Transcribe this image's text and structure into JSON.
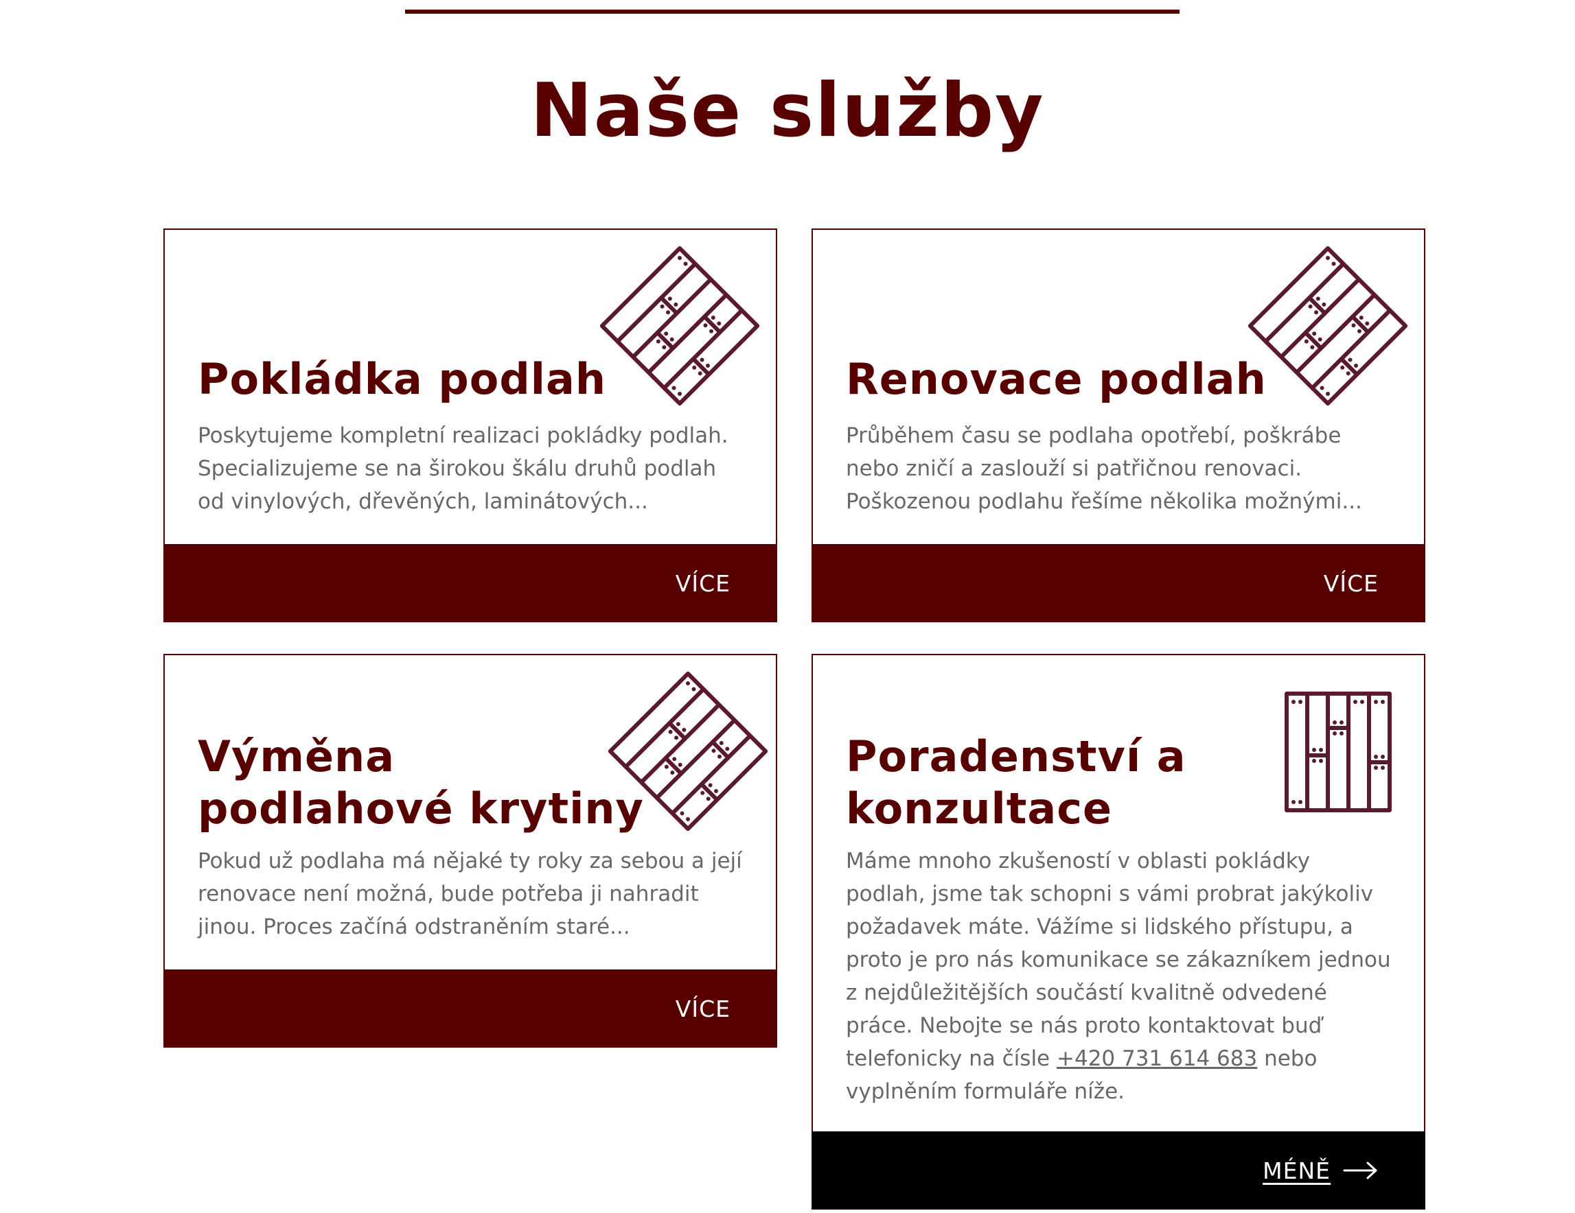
{
  "heading": "Naše služby",
  "colors": {
    "accent": "#580000",
    "text_muted": "#676767",
    "footer_active": "#000000"
  },
  "cards": [
    {
      "title": "Pokládka podlah",
      "text": "Poskytujeme kompletní realizaci pokládky podlah. Specializujeme se na širokou škálu druhů podlah od vinylových, dřevěných, laminátových...",
      "button": "VÍCE",
      "icon": "diagonal-parquet-icon"
    },
    {
      "title": "Renovace podlah",
      "text": "Průběhem času se podlaha opotřebí, poškrábe nebo zničí a zaslouží si patřičnou renovaci. Poškozenou podlahu řešíme několika možnými...",
      "button": "VÍCE",
      "icon": "diagonal-parquet-icon"
    },
    {
      "title_line1": "Výměna",
      "title_line2": "podlahové krytiny",
      "text": "Pokud už podlaha má nějaké ty roky za sebou a její renovace není možná, bude potřeba ji nahradit jinou. Proces začíná odstraněním staré...",
      "button": "VÍCE",
      "icon": "diagonal-parquet-icon"
    },
    {
      "title_line1": "Poradenství a",
      "title_line2": "konzultace",
      "text_before_phone": "Máme mnoho zkušeností v oblasti pokládky podlah, jsme tak schopni s vámi probrat jakýkoliv požadavek máte. Vážíme si lidského přístupu, a proto je pro nás komunikace se zákazníkem jednou z nejdůležitějších součástí kvalitně odvedené práce. Nebojte se nás proto kontaktovat buď telefonicky na čísle ",
      "phone": "+420 731 614 683",
      "text_after_phone": " nebo vyplněním formuláře níže.",
      "button": "MÉNĚ",
      "icon": "vertical-planks-icon"
    }
  ]
}
